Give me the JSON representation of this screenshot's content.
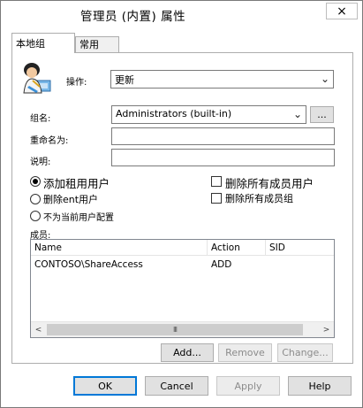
{
  "window": {
    "title": "管理员 (内置) 属性",
    "close_icon": "×"
  },
  "tabs": [
    {
      "label": "本地组",
      "active": true
    },
    {
      "label": "常用",
      "active": false
    }
  ],
  "action": {
    "label": "操作:",
    "value": "更新"
  },
  "group_name": {
    "label": "组名:",
    "value": "Administrators (built-in)",
    "browse_label": "..."
  },
  "rename": {
    "label": "重命名为:",
    "value": ""
  },
  "description": {
    "label": "说明:",
    "value": ""
  },
  "options": {
    "radio_add": "添加租用用户",
    "radio_remove": "删除ent用户",
    "radio_none": "不为当前用户配置",
    "check_delete_users": "删除所有成员用户",
    "check_delete_groups": "删除所有成员组"
  },
  "members": {
    "label": "成员:",
    "columns": [
      "Name",
      "Action",
      "SID"
    ],
    "rows": [
      {
        "name": "CONTOSO\\ShareAccess",
        "action": "ADD",
        "sid": ""
      }
    ],
    "scroll_left": "<",
    "scroll_right": ">",
    "thumb_grip": "III"
  },
  "member_buttons": {
    "add": "Add...",
    "remove": "Remove",
    "change": "Change..."
  },
  "footer": {
    "ok": "OK",
    "cancel": "Cancel",
    "apply": "Apply",
    "help": "Help"
  }
}
